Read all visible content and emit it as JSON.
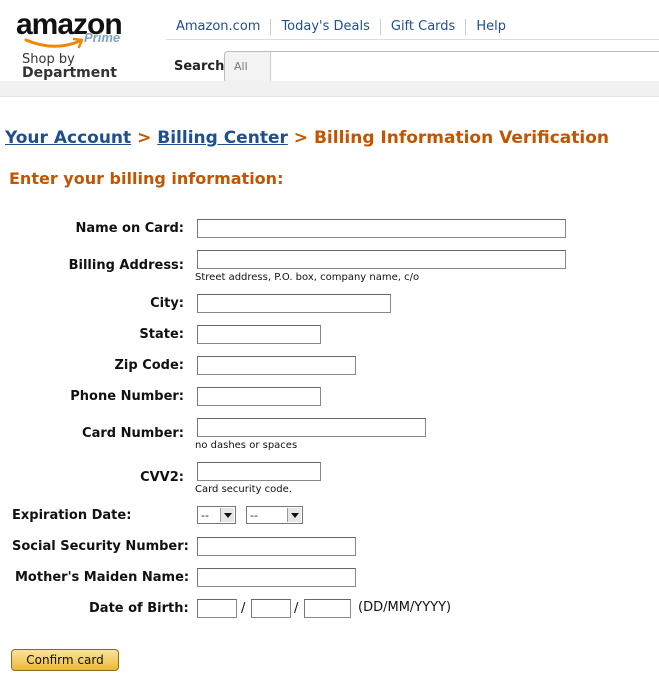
{
  "header": {
    "logo_text": "amazon",
    "logo_sub": "Prime",
    "shop_by": "Shop by",
    "department": "Department",
    "nav": [
      "Amazon.com",
      "Today's Deals",
      "Gift Cards",
      "Help"
    ],
    "search_label": "Search",
    "search_category": "All"
  },
  "breadcrumb": {
    "your_account": "Your Account",
    "billing_center": "Billing Center",
    "separator": ">",
    "current": "Billing Information Verification"
  },
  "form": {
    "heading": "Enter your billing information:",
    "labels": {
      "name_on_card": "Name on Card:",
      "billing_address": "Billing Address:",
      "city": "City:",
      "state": "State:",
      "zip_code": "Zip Code:",
      "phone_number": "Phone Number:",
      "card_number": "Card Number:",
      "cvv2": "CVV2:",
      "expiration_date": "Expiration Date:",
      "ssn": "Social Security Number:",
      "maiden_name": "Mother's Maiden Name:",
      "dob": "Date of Birth:"
    },
    "hints": {
      "billing_address": "Street address, P.O. box, company name, c/o",
      "card_number": "no dashes or spaces",
      "cvv2": "Card security code."
    },
    "expiration": {
      "month_selected": "--",
      "year_selected": "--"
    },
    "dob_separator": "/",
    "dob_format": "(DD/MM/YYYY)",
    "confirm_label": "Confirm card"
  }
}
